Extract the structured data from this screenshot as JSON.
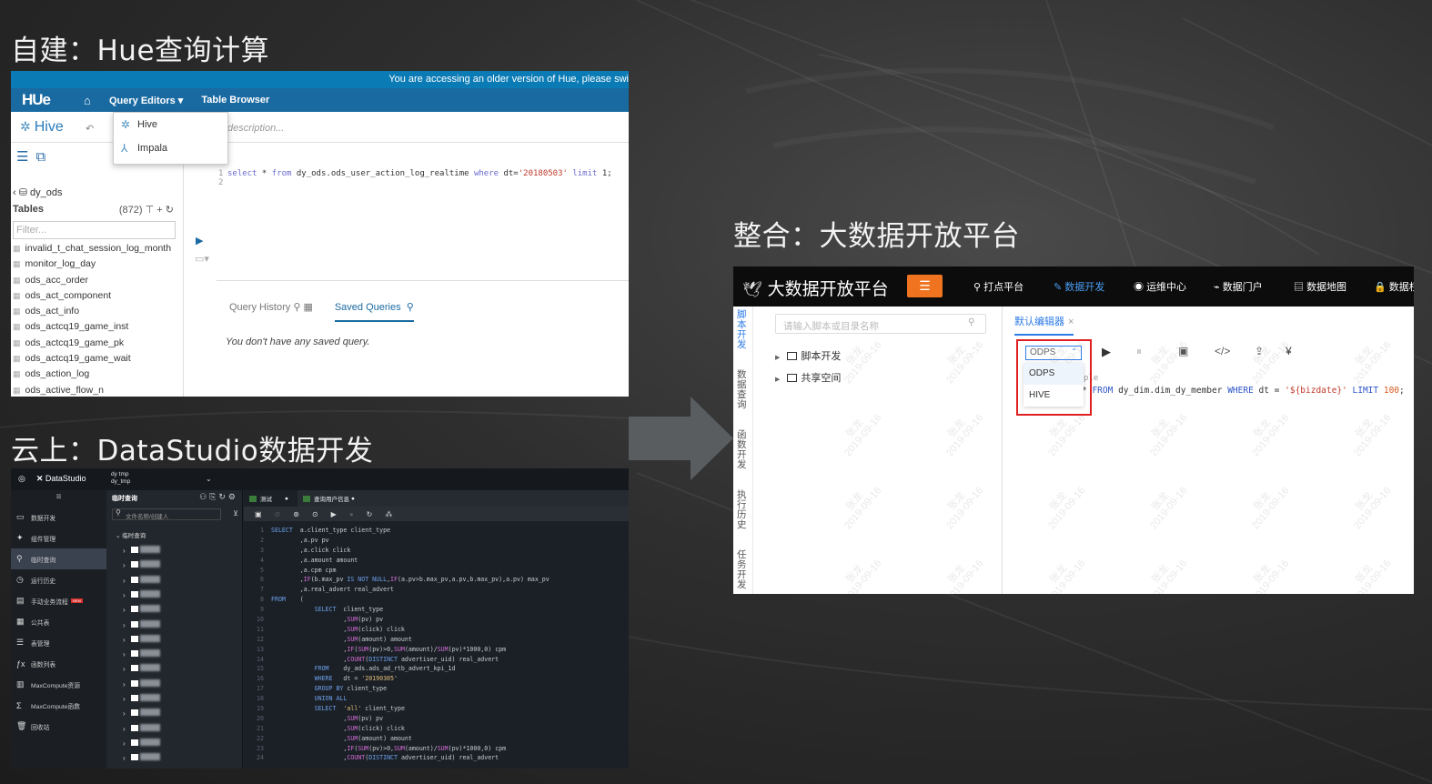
{
  "headings": {
    "hue": "自建：Hue查询计算",
    "datastudio": "云上：DataStudio数据开发",
    "platform": "整合：大数据开放平台"
  },
  "hue": {
    "banner": "You are accessing an older version of Hue, please swi",
    "logo": "HUe",
    "nav": [
      "Query Editors ▾",
      "Table Browser"
    ],
    "editor_name": "Hive",
    "description_placeholder": "description...",
    "dropdown": [
      "Hive",
      "Impala"
    ],
    "database": "dy_ods",
    "tables_label": "Tables",
    "tables_count": "(872)",
    "filter_placeholder": "Filter...",
    "tables": [
      "invalid_t_chat_session_log_month",
      "monitor_log_day",
      "ods_acc_order",
      "ods_act_component",
      "ods_act_info",
      "ods_actcq19_game_inst",
      "ods_actcq19_game_pk",
      "ods_actcq19_game_wait",
      "ods_action_log",
      "ods_active_flow_n"
    ],
    "query_line_numbers": [
      "1",
      "2"
    ],
    "query": {
      "k1": "select",
      "p1": " * ",
      "k2": "from",
      "p2": " dy_ods.ods_user_action_log_realtime ",
      "k3": "where",
      "p3": " dt=",
      "s1": "'20180503'",
      "p4": " ",
      "k4": "limit",
      "p5": " 1;"
    },
    "tabs": [
      "Query History",
      "Saved Queries"
    ],
    "no_saved": "You don't have any saved query."
  },
  "datastudio": {
    "brand": "DataStudio",
    "project_lines": [
      "dy tmp",
      "dy_tmp"
    ],
    "sidebar": [
      {
        "icon": "code-icon",
        "label": "数据开发",
        "active": false,
        "badge": ""
      },
      {
        "icon": "component-icon",
        "label": "组件管理",
        "active": false,
        "badge": ""
      },
      {
        "icon": "search-icon",
        "label": "临时查询",
        "active": true,
        "badge": ""
      },
      {
        "icon": "clock-icon",
        "label": "运行历史",
        "active": false,
        "badge": ""
      },
      {
        "icon": "briefcase-icon",
        "label": "手动业务流程",
        "active": false,
        "badge": "NEW"
      },
      {
        "icon": "table-icon",
        "label": "公共表",
        "active": false,
        "badge": ""
      },
      {
        "icon": "list-icon",
        "label": "表管理",
        "active": false,
        "badge": ""
      },
      {
        "icon": "function-icon",
        "label": "函数列表",
        "active": false,
        "badge": ""
      },
      {
        "icon": "resource-icon",
        "label": "MaxCompute资源",
        "active": false,
        "badge": ""
      },
      {
        "icon": "sigma-icon",
        "label": "MaxCompute函数",
        "active": false,
        "badge": ""
      },
      {
        "icon": "trash-icon",
        "label": "回收站",
        "active": false,
        "badge": ""
      }
    ],
    "tree_title": "临时查询",
    "search_placeholder": "文件名称/创建人",
    "root_folder": "临时查询",
    "tabs": [
      "测试",
      "查询用户信息"
    ],
    "code": [
      [
        {
          "t": "kw",
          "v": "SELECT"
        },
        {
          "t": "c",
          "v": "  a.client_type client_type"
        }
      ],
      [
        {
          "t": "c",
          "v": "        ,a.pv pv"
        }
      ],
      [
        {
          "t": "c",
          "v": "        ,a.click click"
        }
      ],
      [
        {
          "t": "c",
          "v": "        ,a.amount amount"
        }
      ],
      [
        {
          "t": "c",
          "v": "        ,a.cpm cpm"
        }
      ],
      [
        {
          "t": "c",
          "v": "        ,"
        },
        {
          "t": "fn",
          "v": "IF"
        },
        {
          "t": "c",
          "v": "(b.max_pv "
        },
        {
          "t": "kw",
          "v": "IS NOT NULL"
        },
        {
          "t": "c",
          "v": ","
        },
        {
          "t": "fn",
          "v": "IF"
        },
        {
          "t": "c",
          "v": "(a.pv>b.max_pv,a.pv,b.max_pv),a.pv) max_pv"
        }
      ],
      [
        {
          "t": "c",
          "v": "        ,a.real_advert real_advert"
        }
      ],
      [
        {
          "t": "kw",
          "v": "FROM"
        },
        {
          "t": "c",
          "v": "    ("
        }
      ],
      [
        {
          "t": "c",
          "v": "            "
        },
        {
          "t": "kw",
          "v": "SELECT"
        },
        {
          "t": "c",
          "v": "  client_type"
        }
      ],
      [
        {
          "t": "c",
          "v": "                    ,"
        },
        {
          "t": "fn",
          "v": "SUM"
        },
        {
          "t": "c",
          "v": "(pv) pv"
        }
      ],
      [
        {
          "t": "c",
          "v": "                    ,"
        },
        {
          "t": "fn",
          "v": "SUM"
        },
        {
          "t": "c",
          "v": "(click) click"
        }
      ],
      [
        {
          "t": "c",
          "v": "                    ,"
        },
        {
          "t": "fn",
          "v": "SUM"
        },
        {
          "t": "c",
          "v": "(amount) amount"
        }
      ],
      [
        {
          "t": "c",
          "v": "                    ,"
        },
        {
          "t": "fn",
          "v": "IF"
        },
        {
          "t": "c",
          "v": "("
        },
        {
          "t": "fn",
          "v": "SUM"
        },
        {
          "t": "c",
          "v": "(pv)>0,"
        },
        {
          "t": "fn",
          "v": "SUM"
        },
        {
          "t": "c",
          "v": "(amount)/"
        },
        {
          "t": "fn",
          "v": "SUM"
        },
        {
          "t": "c",
          "v": "(pv)*1000,0) cpm"
        }
      ],
      [
        {
          "t": "c",
          "v": "                    ,"
        },
        {
          "t": "fn",
          "v": "COUNT"
        },
        {
          "t": "c",
          "v": "("
        },
        {
          "t": "kw",
          "v": "DISTINCT"
        },
        {
          "t": "c",
          "v": " advertiser_uid) real_advert"
        }
      ],
      [
        {
          "t": "c",
          "v": "            "
        },
        {
          "t": "kw",
          "v": "FROM"
        },
        {
          "t": "c",
          "v": "    dy_ads.ads_ad_rtb_advert_kpi_1d"
        }
      ],
      [
        {
          "t": "c",
          "v": "            "
        },
        {
          "t": "kw",
          "v": "WHERE"
        },
        {
          "t": "c",
          "v": "   dt = "
        },
        {
          "t": "st",
          "v": "'20190305'"
        }
      ],
      [
        {
          "t": "c",
          "v": "            "
        },
        {
          "t": "kw",
          "v": "GROUP BY"
        },
        {
          "t": "c",
          "v": " client_type"
        }
      ],
      [
        {
          "t": "c",
          "v": "            "
        },
        {
          "t": "kw",
          "v": "UNION ALL"
        }
      ],
      [
        {
          "t": "c",
          "v": "            "
        },
        {
          "t": "kw",
          "v": "SELECT"
        },
        {
          "t": "c",
          "v": "  "
        },
        {
          "t": "st",
          "v": "'all'"
        },
        {
          "t": "c",
          "v": " client_type"
        }
      ],
      [
        {
          "t": "c",
          "v": "                    ,"
        },
        {
          "t": "fn",
          "v": "SUM"
        },
        {
          "t": "c",
          "v": "(pv) pv"
        }
      ],
      [
        {
          "t": "c",
          "v": "                    ,"
        },
        {
          "t": "fn",
          "v": "SUM"
        },
        {
          "t": "c",
          "v": "(click) click"
        }
      ],
      [
        {
          "t": "c",
          "v": "                    ,"
        },
        {
          "t": "fn",
          "v": "SUM"
        },
        {
          "t": "c",
          "v": "(amount) amount"
        }
      ],
      [
        {
          "t": "c",
          "v": "                    ,"
        },
        {
          "t": "fn",
          "v": "IF"
        },
        {
          "t": "c",
          "v": "("
        },
        {
          "t": "fn",
          "v": "SUM"
        },
        {
          "t": "c",
          "v": "(pv)>0,"
        },
        {
          "t": "fn",
          "v": "SUM"
        },
        {
          "t": "c",
          "v": "(amount)/"
        },
        {
          "t": "fn",
          "v": "SUM"
        },
        {
          "t": "c",
          "v": "(pv)*1000,0) cpm"
        }
      ],
      [
        {
          "t": "c",
          "v": "                    ,"
        },
        {
          "t": "fn",
          "v": "COUNT"
        },
        {
          "t": "c",
          "v": "("
        },
        {
          "t": "kw",
          "v": "DISTINCT"
        },
        {
          "t": "c",
          "v": " advertiser_uid) real_advert"
        }
      ]
    ]
  },
  "platform": {
    "title": "大数据开放平台",
    "nav": [
      {
        "icon": "pin-icon",
        "label": "打点平台",
        "active": false
      },
      {
        "icon": "edit-icon",
        "label": "数据开发",
        "active": true
      },
      {
        "icon": "location-icon",
        "label": "运维中心",
        "active": false
      },
      {
        "icon": "chart-icon",
        "label": "数据门户",
        "active": false
      },
      {
        "icon": "doc-icon",
        "label": "数据地图",
        "active": false
      },
      {
        "icon": "lock-icon",
        "label": "数据权",
        "active": false
      }
    ],
    "side_tabs": [
      "脚本开发",
      "数据查询",
      "函数开发",
      "执行历史",
      "任务开发"
    ],
    "search_placeholder": "请输入脚本或目录名称",
    "tree": [
      "脚本开发",
      "共享空间"
    ],
    "editor_tab": "默认编辑器",
    "engine_selected": "ODPS",
    "engine_options": [
      "ODPS",
      "HIVE"
    ],
    "sql_fragment_above": "ple",
    "sql": {
      "p0": "* ",
      "k1": "FROM",
      "p1": " dy_dim.dim_dy_member ",
      "k2": "WHERE",
      "p2": " dt = ",
      "s1": "'${bizdate}'",
      "p3": " ",
      "k3": "LIMIT",
      "p4": " ",
      "n1": "100",
      "p5": ";"
    },
    "watermark": [
      "张龙",
      "2019-09-16"
    ]
  },
  "colors": {
    "hue_nav": "#1a6aa2",
    "platform_accent": "#f07320",
    "platform_link": "#2d7be6",
    "highlight_box": "#e02020"
  }
}
